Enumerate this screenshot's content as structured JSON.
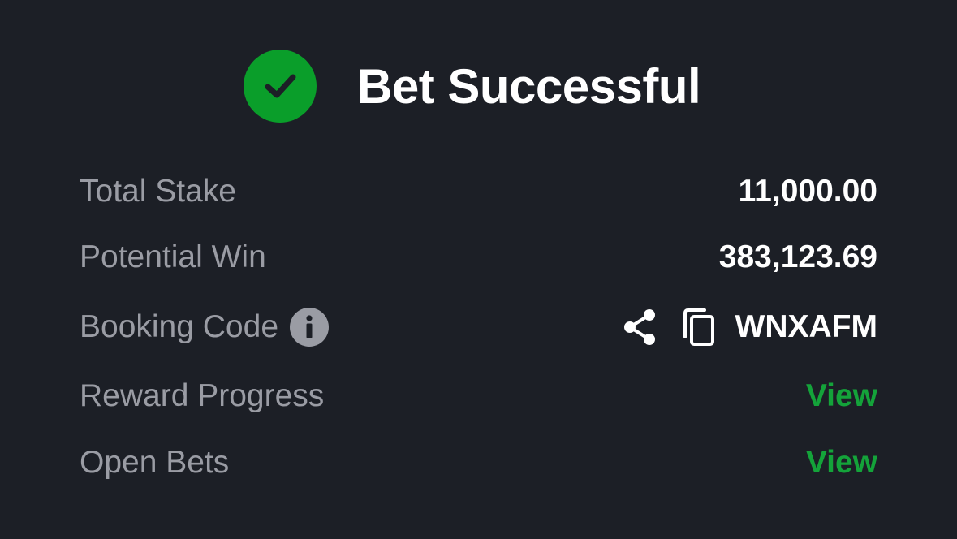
{
  "header": {
    "title": "Bet Successful",
    "icon": "check-circle-icon",
    "accent_color": "#0a9e2a"
  },
  "details": {
    "total_stake": {
      "label": "Total Stake",
      "value": "11,000.00"
    },
    "potential_win": {
      "label": "Potential Win",
      "value": "383,123.69"
    },
    "booking_code": {
      "label": "Booking Code",
      "info_icon": "info-icon",
      "share_icon": "share-icon",
      "copy_icon": "copy-icon",
      "value": "WNXAFM"
    },
    "reward_progress": {
      "label": "Reward Progress",
      "link": "View"
    },
    "open_bets": {
      "label": "Open Bets",
      "link": "View"
    }
  },
  "colors": {
    "background": "#1c1f26",
    "label": "#9a9ca4",
    "value": "#ffffff",
    "link": "#14a33a"
  }
}
